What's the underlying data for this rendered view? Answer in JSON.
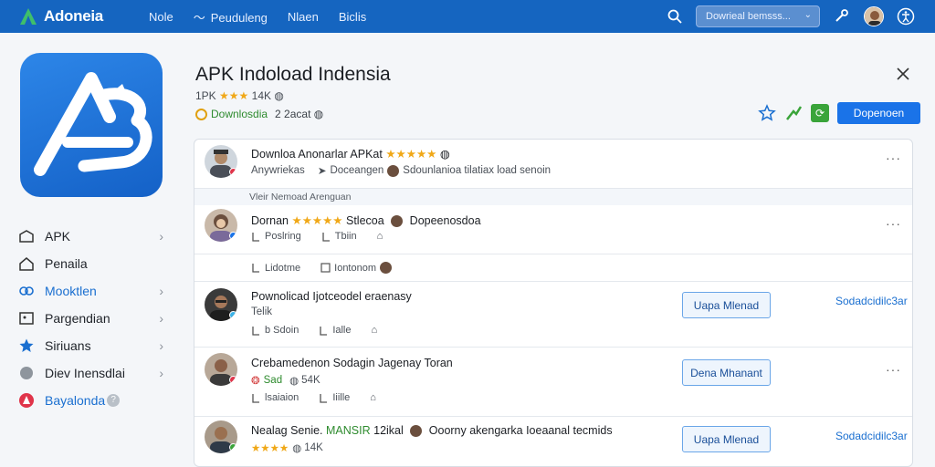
{
  "brand": {
    "name": "Adoneia"
  },
  "nav": {
    "items": [
      "Nole",
      "Peuduleng",
      "Nlaen",
      "Biclis"
    ]
  },
  "topbar": {
    "search_placeholder": "Dowrieal bemsss...",
    "search_chevron": "⌄"
  },
  "side": {
    "items": [
      {
        "label": "APK",
        "chevron": true,
        "color": "#1f2329"
      },
      {
        "label": "Penaila",
        "chevron": false,
        "color": "#1f2329"
      },
      {
        "label": "Mooktlen",
        "chevron": true,
        "color": "#1a6fd0"
      },
      {
        "label": "Pargendian",
        "chevron": true,
        "color": "#1f2329"
      },
      {
        "label": "Siriuans",
        "chevron": true,
        "color": "#1f2329"
      },
      {
        "label": "Diev Inensdlai",
        "chevron": true,
        "color": "#1f2329"
      },
      {
        "label": "Bayalonda",
        "badge": "?",
        "color": "#1a6fd0"
      }
    ]
  },
  "header": {
    "title": "APK Indoload Indensia",
    "meta1_prefix": "1PK",
    "meta1_stars": "★★★",
    "meta1_count": "14K",
    "meta2_status": "Downlosdia",
    "meta2_extra": "2 2acat",
    "primary_button": "Dopenoen"
  },
  "card": {
    "section_label": "Vleir Nemoad Arenguan",
    "row1": {
      "title_text": "Downloa Anonarlar APKat",
      "title_stars": "★★★★★",
      "sub_a": "Anywriekas",
      "sub_b": "Doceangen",
      "sub_c": "Sdounlanioa tilatiax load senoin"
    },
    "row2": {
      "title_a": "Dornan",
      "title_stars": "★★★★★",
      "title_b": "Stlecoa",
      "title_c": "Dopeenosdoa",
      "stat1": "Poslring",
      "stat2": "Tbiin"
    },
    "row3": {
      "stat1": "Lidotme",
      "stat2": "Iontonom"
    },
    "row4": {
      "title": "Pownolicad Ijotceodel eraenasy",
      "sub": "Telik",
      "stat1": "b Sdoin",
      "stat2": "Ialle",
      "button": "Uapa Mlenad",
      "link": "Sodadcidilc3ar"
    },
    "row5": {
      "title": "Crebamedenon Sodagin Jagenay Toran",
      "sub_a": "Sad",
      "sub_b": "54K",
      "stat1": "lsaiaion",
      "stat2": "Iiille",
      "button": "Dena Mhanant"
    },
    "row6": {
      "title_a": "Nealag Senie.",
      "title_green": "MANSIR",
      "title_b": "12ikal",
      "title_c": "Ooorny akengarka Ioeaanal tecmids",
      "sub_stars": "★★★★",
      "sub_count": "14K",
      "button": "Uapa Mlenad",
      "link": "Sodadcidilc3ar"
    }
  },
  "colors": {
    "topbar": "#1565c0",
    "accent": "#1a73e8",
    "green": "#2e8b2e",
    "star": "#f0a818"
  }
}
